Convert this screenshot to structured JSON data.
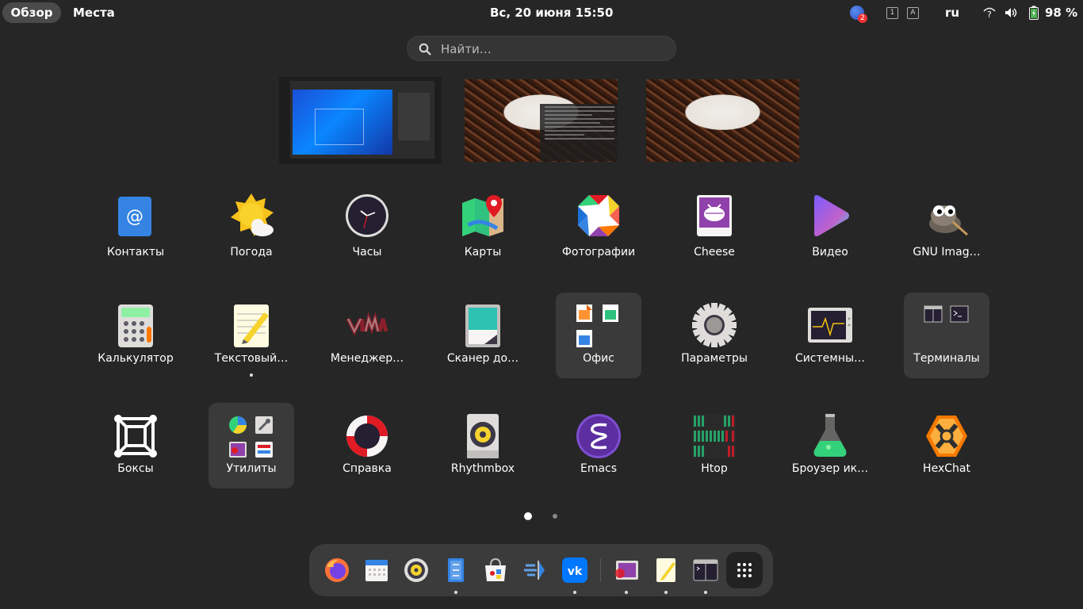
{
  "topbar": {
    "overview_label": "Обзор",
    "places_label": "Места",
    "datetime": "Вс, 20 июня  15:50",
    "notification_count": "2",
    "kbd_1": "1",
    "kbd_a": "A",
    "language": "ru",
    "battery": "98 %"
  },
  "search": {
    "placeholder": "Найти…"
  },
  "apps": [
    {
      "label": "Контакты"
    },
    {
      "label": "Погода"
    },
    {
      "label": "Часы"
    },
    {
      "label": "Карты"
    },
    {
      "label": "Фотографии"
    },
    {
      "label": "Cheese"
    },
    {
      "label": "Видео"
    },
    {
      "label": "GNU Imag…"
    },
    {
      "label": "Калькулятор"
    },
    {
      "label": "Текстовый…"
    },
    {
      "label": "Менеджер…"
    },
    {
      "label": "Сканер до…"
    },
    {
      "label": "Офис"
    },
    {
      "label": "Параметры"
    },
    {
      "label": "Системны…"
    },
    {
      "label": "Терминалы"
    },
    {
      "label": "Боксы"
    },
    {
      "label": "Утилиты"
    },
    {
      "label": "Справка"
    },
    {
      "label": "Rhythmbox"
    },
    {
      "label": "Emacs"
    },
    {
      "label": "Htop"
    },
    {
      "label": "Броузер ик…"
    },
    {
      "label": "HexChat"
    }
  ],
  "pager": {
    "pages": 2,
    "current": 1
  },
  "dock": [
    "firefox-icon",
    "calendar-icon",
    "rhythmbox-icon",
    "files-icon",
    "software-icon",
    "transmission-icon",
    "vk-icon",
    "image-viewer-icon",
    "text-editor-icon",
    "terminal-icon",
    "show-apps-icon"
  ],
  "colors": {
    "background": "#262626",
    "panel": "#3b3b3b",
    "folder": "#3a3a3a"
  }
}
